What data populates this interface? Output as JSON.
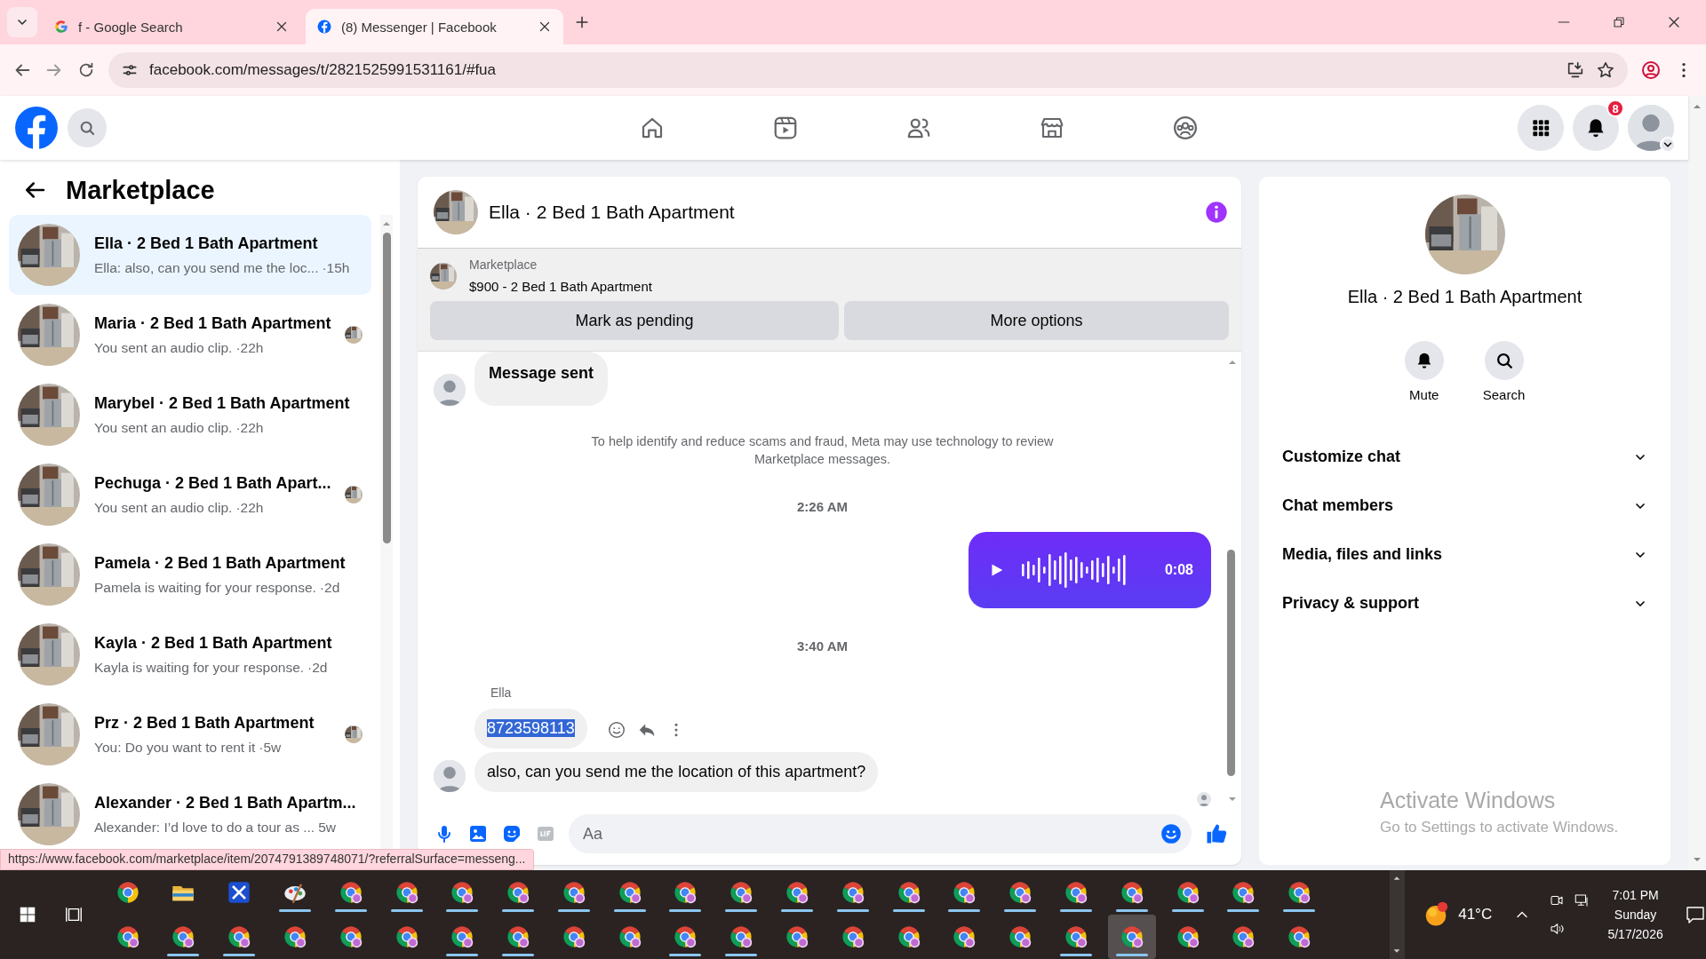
{
  "browser": {
    "tabs": [
      {
        "title": "f - Google Search",
        "kind": "google",
        "selected": false
      },
      {
        "title": "(8) Messenger | Facebook",
        "kind": "facebook",
        "selected": true
      }
    ],
    "address": "facebook.com/messages/t/2821525991531161/#fua",
    "status_url": "https://www.facebook.com/marketplace/item/2074791389748071/?referralSurface=messeng..."
  },
  "header": {
    "nav": [
      {
        "kind": "home"
      },
      {
        "kind": "video"
      },
      {
        "kind": "friends"
      },
      {
        "kind": "store"
      },
      {
        "kind": "groups"
      }
    ],
    "notification_count": "8"
  },
  "sidebar": {
    "title": "Marketplace",
    "conversations": [
      {
        "title": "Ella · 2 Bed 1 Bath Apartment",
        "preview": "Ella: also, can you send me the loc...",
        "time": "·15h",
        "selected": true,
        "seen": false
      },
      {
        "title": "Maria · 2 Bed 1 Bath Apartment",
        "preview": "You sent an audio clip.",
        "time": "·22h",
        "selected": false,
        "seen": true
      },
      {
        "title": "Marybel · 2 Bed 1 Bath Apartment",
        "preview": "You sent an audio clip.",
        "time": "·22h",
        "selected": false,
        "seen": false
      },
      {
        "title": "Pechuga · 2 Bed 1 Bath Apart...",
        "preview": "You sent an audio clip.",
        "time": "·22h",
        "selected": false,
        "seen": true
      },
      {
        "title": "Pamela · 2 Bed 1 Bath Apartment",
        "preview": "Pamela is waiting for your response.",
        "time": "·2d",
        "selected": false,
        "seen": false
      },
      {
        "title": "Kayla · 2 Bed 1 Bath Apartment",
        "preview": "Kayla is waiting for your response.",
        "time": "·2d",
        "selected": false,
        "seen": false
      },
      {
        "title": "Prz · 2 Bed 1 Bath Apartment",
        "preview": "You: Do you want to rent it",
        "time": "·5w",
        "selected": false,
        "seen": true
      },
      {
        "title": "Alexander · 2 Bed 1 Bath Apartm...",
        "preview": "Alexander: I’d love to do a tour as ...",
        "time": "5w",
        "selected": false,
        "seen": false
      }
    ]
  },
  "chat": {
    "title": "Ella · 2 Bed 1 Bath Apartment",
    "listing": {
      "label": "Marketplace",
      "title": "$900 - 2 Bed 1 Bath Apartment"
    },
    "buttons": [
      "Mark as pending",
      "More options"
    ],
    "messages": [
      {
        "kind": "status",
        "text": "Message sent"
      },
      {
        "kind": "notice",
        "text": "To help identify and reduce scams and fraud, Meta may use technology to review Marketplace messages."
      },
      {
        "kind": "time",
        "text": "2:26 AM"
      },
      {
        "kind": "audio",
        "duration": "0:08"
      },
      {
        "kind": "time",
        "text": "3:40 AM"
      },
      {
        "kind": "sender",
        "text": "Ella"
      },
      {
        "kind": "incoming",
        "text": "8723598113",
        "highlighted": true,
        "actions": true,
        "avatar": false
      },
      {
        "kind": "incoming",
        "text": "also, can you send me the location of this apartment?",
        "highlighted": false,
        "actions": false,
        "avatar": true
      }
    ],
    "composer": {
      "placeholder": "Aa"
    }
  },
  "details": {
    "title": "Ella · 2 Bed 1 Bath Apartment",
    "actions": [
      {
        "label": "Mute",
        "kind": "mute"
      },
      {
        "label": "Search",
        "kind": "search"
      }
    ],
    "sections": [
      {
        "label": "Customize chat",
        "expanded": false
      },
      {
        "label": "Chat members",
        "expanded": false
      },
      {
        "label": "Media, files and links",
        "expanded": false
      },
      {
        "label": "Privacy & support",
        "expanded": false
      }
    ]
  },
  "activation": {
    "title": "Activate Windows",
    "subtitle": "Go to Settings to activate Windows."
  },
  "taskbar": {
    "rows": [
      [
        {
          "kind": "chrome",
          "open": false,
          "selected": false
        },
        {
          "kind": "folder",
          "open": false,
          "selected": false
        },
        {
          "kind": "app",
          "open": false,
          "selected": false
        },
        {
          "kind": "paint",
          "open": true,
          "selected": false
        },
        {
          "kind": "profile",
          "open": true,
          "selected": false
        },
        {
          "kind": "profile",
          "open": true,
          "selected": false
        },
        {
          "kind": "profile",
          "open": true,
          "selected": false
        },
        {
          "kind": "profile",
          "open": true,
          "selected": false
        },
        {
          "kind": "profile",
          "open": true,
          "selected": false
        },
        {
          "kind": "profile",
          "open": true,
          "selected": false
        },
        {
          "kind": "profile",
          "open": true,
          "selected": false
        },
        {
          "kind": "profile",
          "open": true,
          "selected": false
        },
        {
          "kind": "profile",
          "open": true,
          "selected": false
        },
        {
          "kind": "profile",
          "open": true,
          "selected": false
        },
        {
          "kind": "profile",
          "open": true,
          "selected": false
        },
        {
          "kind": "profile",
          "open": true,
          "selected": false
        },
        {
          "kind": "profile",
          "open": true,
          "selected": false
        },
        {
          "kind": "profile",
          "open": true,
          "selected": false
        },
        {
          "kind": "profile",
          "open": true,
          "selected": false
        },
        {
          "kind": "profile",
          "open": true,
          "selected": false
        },
        {
          "kind": "profile",
          "open": true,
          "selected": false
        },
        {
          "kind": "profile",
          "open": true,
          "selected": false
        }
      ],
      [
        {
          "kind": "profile",
          "open": false,
          "selected": false
        },
        {
          "kind": "profile",
          "open": true,
          "selected": false
        },
        {
          "kind": "profile",
          "open": true,
          "selected": false
        },
        {
          "kind": "profile",
          "open": false,
          "selected": false
        },
        {
          "kind": "profile",
          "open": false,
          "selected": false
        },
        {
          "kind": "profile",
          "open": false,
          "selected": false
        },
        {
          "kind": "profile",
          "open": true,
          "selected": false
        },
        {
          "kind": "profile",
          "open": true,
          "selected": false
        },
        {
          "kind": "profile",
          "open": false,
          "selected": false
        },
        {
          "kind": "profile",
          "open": false,
          "selected": false
        },
        {
          "kind": "profile",
          "open": true,
          "selected": false
        },
        {
          "kind": "profile",
          "open": true,
          "selected": false
        },
        {
          "kind": "profile",
          "open": false,
          "selected": false
        },
        {
          "kind": "profile",
          "open": false,
          "selected": false
        },
        {
          "kind": "profile",
          "open": false,
          "selected": false
        },
        {
          "kind": "profile",
          "open": false,
          "selected": false
        },
        {
          "kind": "profile",
          "open": false,
          "selected": false
        },
        {
          "kind": "profile",
          "open": true,
          "selected": false
        },
        {
          "kind": "profile",
          "open": true,
          "selected": true
        },
        {
          "kind": "profile",
          "open": false,
          "selected": false
        },
        {
          "kind": "profile",
          "open": false,
          "selected": false
        },
        {
          "kind": "profile",
          "open": false,
          "selected": false
        }
      ]
    ],
    "weather": "41°C",
    "clock": {
      "time": "7:01 PM",
      "day": "Sunday",
      "date": "5/17/2026"
    }
  }
}
